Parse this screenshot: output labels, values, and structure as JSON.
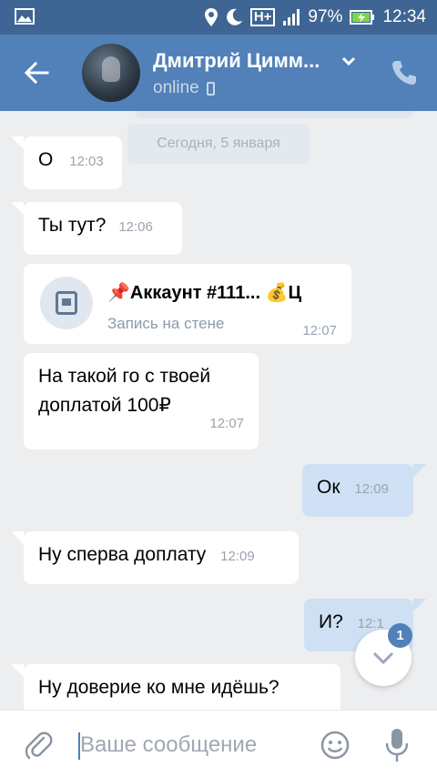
{
  "status_bar": {
    "network": "H+",
    "battery_percent": "97%",
    "time": "12:34",
    "icons": [
      "gallery-icon",
      "location-icon",
      "moon-icon",
      "signal-icon",
      "battery-charging-icon"
    ]
  },
  "header": {
    "contact_name": "Дмитрий Цимм...",
    "status": "online",
    "icons": [
      "back-arrow-icon",
      "chevron-down-icon",
      "mobile-phone-icon",
      "call-icon"
    ]
  },
  "feed": {
    "date_divider": "Сегодня, 5 января",
    "messages": [
      {
        "direction": "in",
        "text": "О",
        "time": "12:03"
      },
      {
        "direction": "in",
        "text": "Ты тут?",
        "time": "12:06"
      },
      {
        "direction": "in",
        "type": "wall_post",
        "title": "📌Аккаунт #111... 💰Ц",
        "subtitle": "Запись на стене",
        "time": "12:07"
      },
      {
        "direction": "in",
        "text": "На такой го с твоей доплатой 100₽",
        "time": "12:07"
      },
      {
        "direction": "out",
        "text": "Ок",
        "time": "12:09"
      },
      {
        "direction": "in",
        "text": "Ну сперва доплату",
        "time": "12:09"
      },
      {
        "direction": "out",
        "text": "И?",
        "time": "12:1"
      },
      {
        "direction": "in",
        "text": "Ну доверие ко мне идёшь?",
        "time": ""
      }
    ]
  },
  "scroll_down": {
    "badge": "1"
  },
  "composer": {
    "placeholder": "Ваше сообщение",
    "value": ""
  },
  "colors": {
    "header": "#5181b8",
    "status_bar": "#3e6593",
    "background": "#edeef0",
    "outgoing_bubble": "#cfe0f4"
  }
}
